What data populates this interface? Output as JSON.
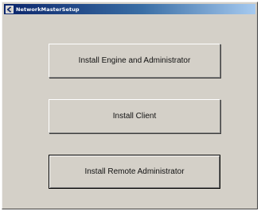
{
  "window": {
    "title": "NetworkMasterSetup"
  },
  "buttons": {
    "install_engine_admin": "Install Engine and Administrator",
    "install_client": "Install Client",
    "install_remote_admin": "Install Remote Administrator"
  },
  "colors": {
    "face": "#d4d0c8",
    "title_start": "#0a246a",
    "title_end": "#a6caf0"
  },
  "icons": {
    "app": "setup-app-icon"
  }
}
